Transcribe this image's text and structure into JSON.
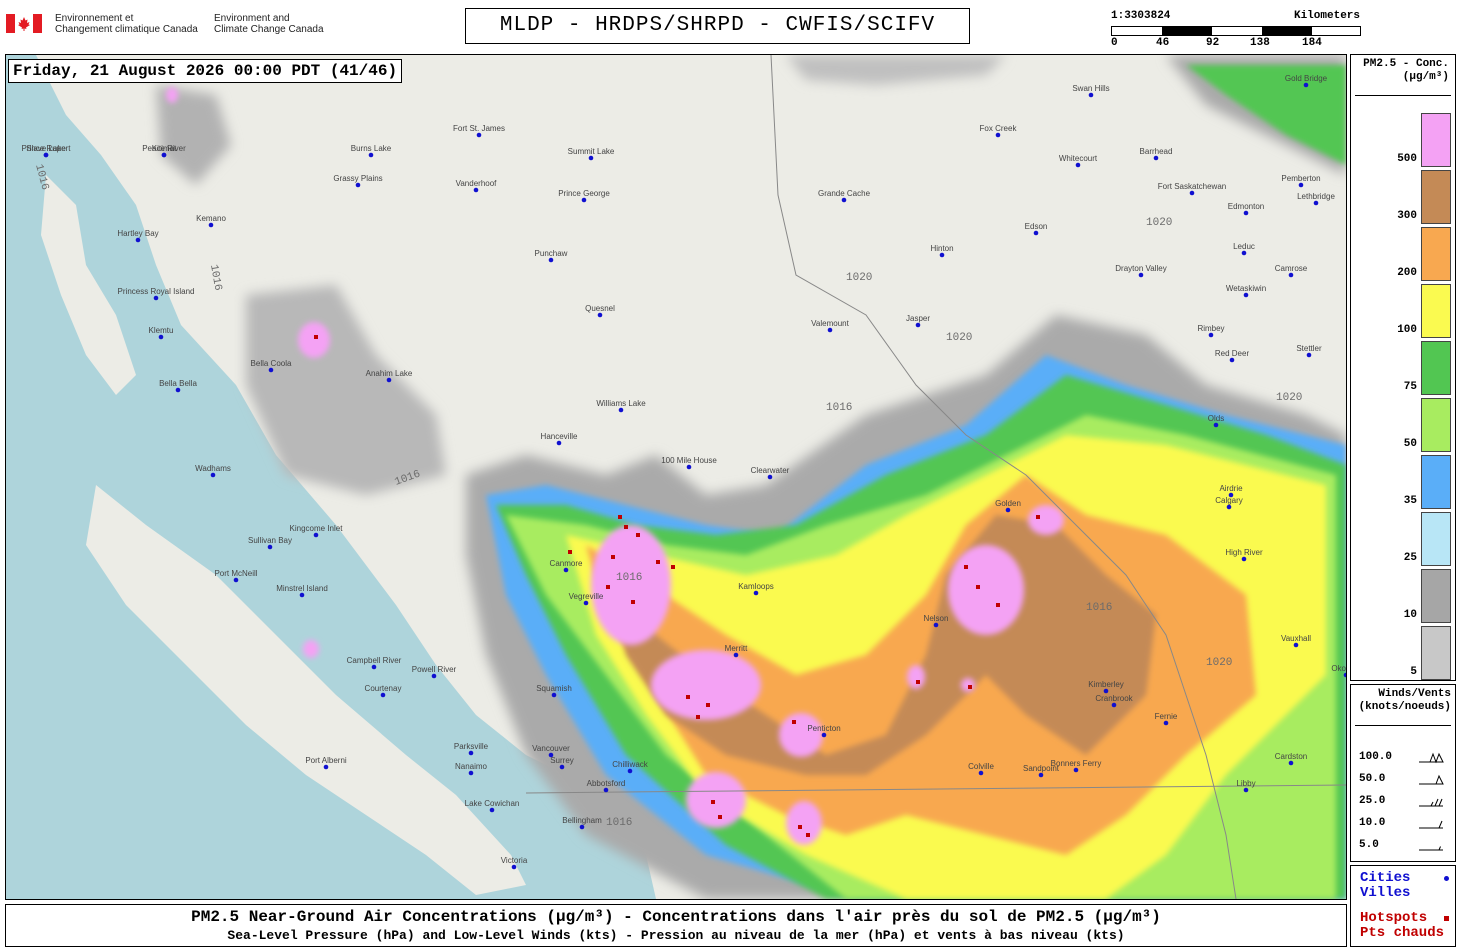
{
  "header": {
    "agency_fr": [
      "Environnement et",
      "Changement climatique Canada"
    ],
    "agency_en": [
      "Environment and",
      "Climate Change Canada"
    ],
    "title": "MLDP - HRDPS/SHRPD - CWFIS/SCIFV",
    "scale": {
      "ratio": "1:3303824",
      "unit": "Kilometers",
      "ticks": [
        "0",
        "46",
        "92",
        "138",
        "184"
      ]
    }
  },
  "map": {
    "timestamp": "Friday, 21 August 2026 00:00 PDT (41/46)",
    "colors": {
      "land": "#ecece6",
      "water": "#aed4db",
      "gray_light": "#c8c8c8",
      "gray": "#a6a6a6",
      "lightblue": "#b8e6f6",
      "blue": "#5aaef8",
      "lightgreen": "#a8ec60",
      "green": "#52c652",
      "yellow": "#fafa50",
      "orange": "#f8a850",
      "brown": "#c48a56",
      "pink": "#f4a2f4",
      "city_dot": "#1010d0",
      "hotspot": "#c00000"
    },
    "isobar_labels": [
      "1016",
      "1020"
    ],
    "cities": [
      {
        "name": "Prince Rupert"
      },
      {
        "name": "Kitimat"
      },
      {
        "name": "Kemano"
      },
      {
        "name": "Hartley Bay"
      },
      {
        "name": "Burns Lake"
      },
      {
        "name": "Grassy Plains"
      },
      {
        "name": "Fort St. James"
      },
      {
        "name": "Summit Lake"
      },
      {
        "name": "Vanderhoof"
      },
      {
        "name": "Prince George"
      },
      {
        "name": "Punchaw"
      },
      {
        "name": "Quesnel"
      },
      {
        "name": "Princess Royal Island"
      },
      {
        "name": "Klemtu"
      },
      {
        "name": "Bella Bella"
      },
      {
        "name": "Bella Coola"
      },
      {
        "name": "Anahim Lake"
      },
      {
        "name": "Williams Lake"
      },
      {
        "name": "Hanceville"
      },
      {
        "name": "100 Mile House"
      },
      {
        "name": "Clearwater"
      },
      {
        "name": "Valemount"
      },
      {
        "name": "Jasper"
      },
      {
        "name": "Grande Cache"
      },
      {
        "name": "Hinton"
      },
      {
        "name": "Edson"
      },
      {
        "name": "Fox Creek"
      },
      {
        "name": "Whitecourt"
      },
      {
        "name": "Swan Hills"
      },
      {
        "name": "Barrhead"
      },
      {
        "name": "Fort Saskatchewan"
      },
      {
        "name": "Edmonton"
      },
      {
        "name": "Leduc"
      },
      {
        "name": "Drayton Valley"
      },
      {
        "name": "Wetaskiwin"
      },
      {
        "name": "Camrose"
      },
      {
        "name": "Rimbey"
      },
      {
        "name": "Red Deer"
      },
      {
        "name": "Stettler"
      },
      {
        "name": "Olds"
      },
      {
        "name": "Airdrie"
      },
      {
        "name": "Calgary"
      },
      {
        "name": "High River"
      },
      {
        "name": "Vauxhall"
      },
      {
        "name": "Wadhams"
      },
      {
        "name": "Sullivan Bay"
      },
      {
        "name": "Kingcome Inlet"
      },
      {
        "name": "Port McNeill"
      },
      {
        "name": "Minstrel Island"
      },
      {
        "name": "Campbell River"
      },
      {
        "name": "Powell River"
      },
      {
        "name": "Courtenay"
      },
      {
        "name": "Squamish"
      },
      {
        "name": "Port Alberni"
      },
      {
        "name": "Parksville"
      },
      {
        "name": "Nanaimo"
      },
      {
        "name": "Vancouver"
      },
      {
        "name": "Surrey"
      },
      {
        "name": "Abbotsford"
      },
      {
        "name": "Chilliwack"
      },
      {
        "name": "Bellingham"
      },
      {
        "name": "Lake Cowichan"
      },
      {
        "name": "Victoria"
      },
      {
        "name": "Merritt"
      },
      {
        "name": "Kamloops"
      },
      {
        "name": "Golden"
      },
      {
        "name": "Penticton"
      },
      {
        "name": "Nelson"
      },
      {
        "name": "Kimberley"
      },
      {
        "name": "Cranbrook"
      },
      {
        "name": "Fernie"
      },
      {
        "name": "Bonners Ferry"
      },
      {
        "name": "Colville"
      },
      {
        "name": "Sandpoint"
      },
      {
        "name": "Libby"
      },
      {
        "name": "Cardston"
      },
      {
        "name": "Okotoks"
      },
      {
        "name": "Lethbridge"
      },
      {
        "name": "Canmore"
      },
      {
        "name": "Vegreville"
      },
      {
        "name": "Gold Bridge"
      },
      {
        "name": "Pemberton"
      },
      {
        "name": "Slave Lake"
      },
      {
        "name": "Peace River"
      }
    ]
  },
  "legend": {
    "title": [
      "PM2.5 - Conc.",
      "(µg/m³)"
    ],
    "bins": [
      {
        "label": "500",
        "color": "#f4a2f4"
      },
      {
        "label": "300",
        "color": "#c48a56"
      },
      {
        "label": "200",
        "color": "#f8a850"
      },
      {
        "label": "100",
        "color": "#fafa50"
      },
      {
        "label": "75",
        "color": "#52c652"
      },
      {
        "label": "50",
        "color": "#a8ec60"
      },
      {
        "label": "35",
        "color": "#5aaef8"
      },
      {
        "label": "25",
        "color": "#b8e6f6"
      },
      {
        "label": "10",
        "color": "#a6a6a6"
      },
      {
        "label": "5",
        "color": "#c8c8c8"
      }
    ]
  },
  "winds_legend": {
    "title": [
      "Winds/Vents",
      "(knots/noeuds)"
    ],
    "rows": [
      "100.0",
      "50.0",
      "25.0",
      "10.0",
      "5.0"
    ]
  },
  "points_legend": {
    "cities": [
      "Cities",
      "Villes"
    ],
    "hotspots": [
      "Hotspots",
      "Pts chauds"
    ]
  },
  "caption": {
    "main": "PM2.5 Near-Ground Air Concentrations (µg/m³) - Concentrations dans l'air près du sol de PM2.5 (µg/m³)",
    "sub": "Sea-Level Pressure (hPa) and Low-Level Winds (kts) - Pression au niveau de la mer (hPa) et vents à bas niveau (kts)"
  }
}
